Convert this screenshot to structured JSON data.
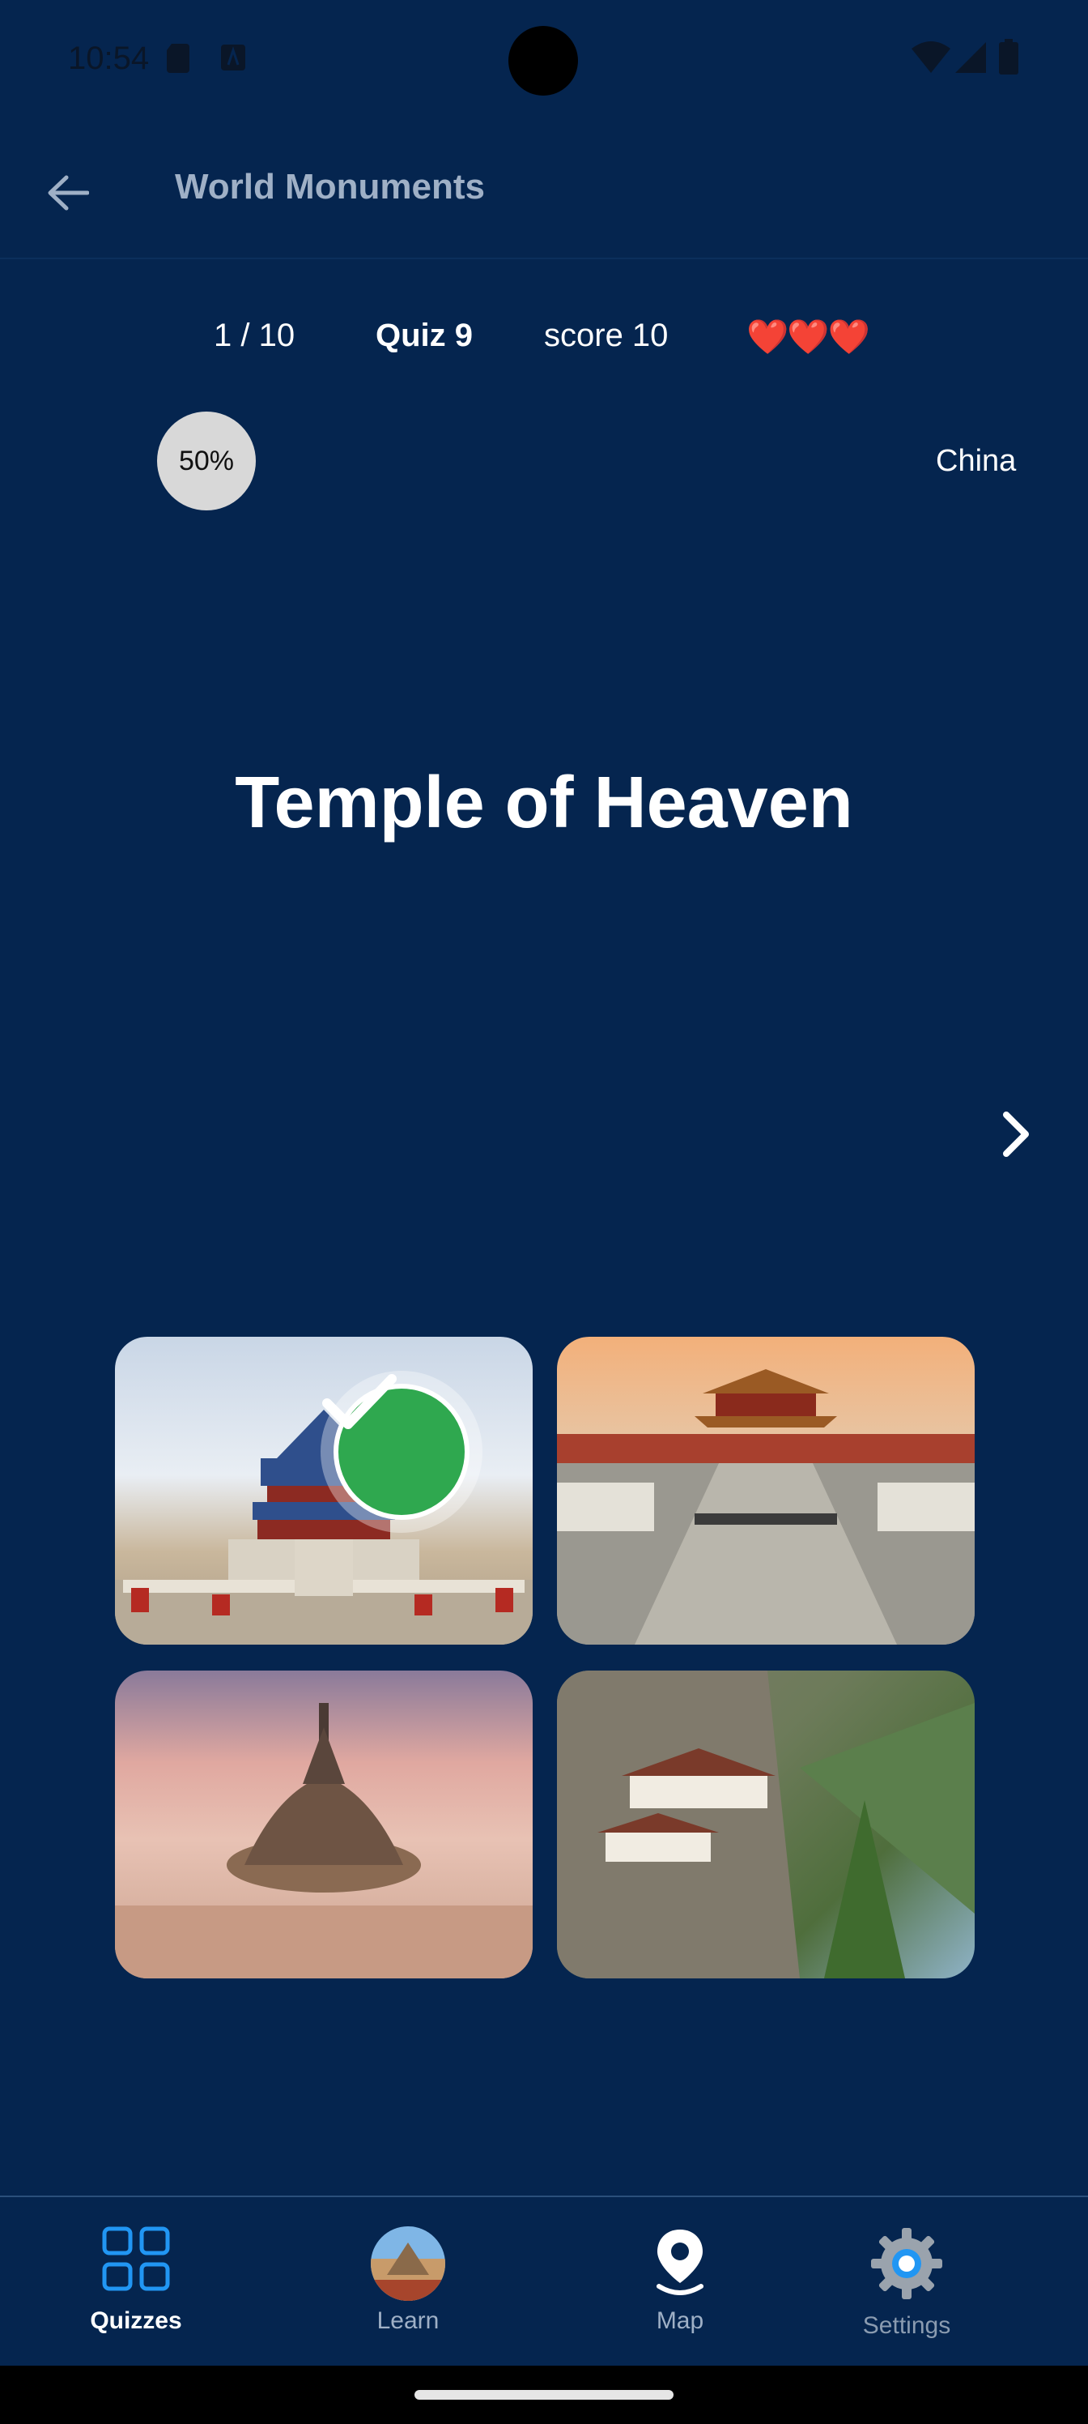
{
  "status_bar": {
    "time": "10:54",
    "left_icons": [
      "sd-card-icon",
      "a-box-icon"
    ],
    "right_icons": [
      "wifi-icon",
      "signal-icon",
      "battery-icon"
    ]
  },
  "app_bar": {
    "title": "World Monuments",
    "back_icon": "arrow-left-icon"
  },
  "stats": {
    "progress": "1 / 10",
    "quiz": "Quiz 9",
    "score": "score 10",
    "hearts": "❤️❤️❤️",
    "lives": 3
  },
  "percent": "50%",
  "country": "China",
  "question": "Temple of Heaven",
  "options": [
    {
      "image": "temple-of-heaven",
      "state": "correct"
    },
    {
      "image": "forbidden-city",
      "state": "none"
    },
    {
      "image": "mont-saint-michel",
      "state": "none"
    },
    {
      "image": "tigers-nest-monastery",
      "state": "none"
    }
  ],
  "nav": {
    "items": [
      {
        "label": "Quizzes",
        "icon": "grid-icon",
        "active": true
      },
      {
        "label": "Learn",
        "icon": "learn-avatar-icon",
        "active": false
      },
      {
        "label": "Map",
        "icon": "map-pin-icon",
        "active": false
      },
      {
        "label": "Settings",
        "icon": "gear-icon",
        "active": false
      }
    ]
  },
  "colors": {
    "background": "#05254F",
    "accent": "#2196F3",
    "correct": "#2fa84f",
    "heart": "#e53935"
  }
}
